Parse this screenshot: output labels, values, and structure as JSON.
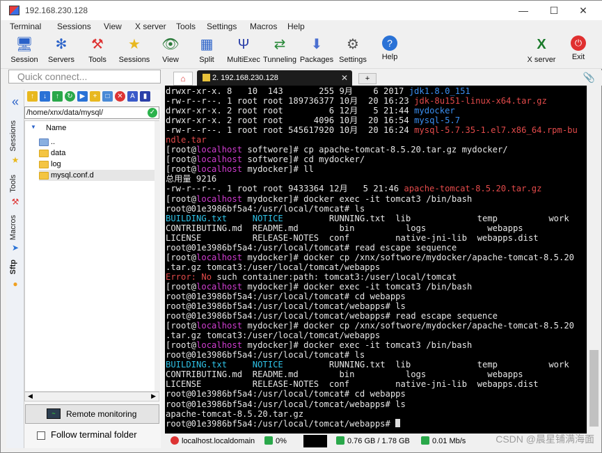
{
  "window": {
    "title": "192.168.230.128"
  },
  "menu": [
    "Terminal",
    "Sessions",
    "View",
    "X server",
    "Tools",
    "Settings",
    "Macros",
    "Help"
  ],
  "toolbar": {
    "items": [
      "Session",
      "Servers",
      "Tools",
      "Sessions",
      "View",
      "Split",
      "MultiExec",
      "Tunneling",
      "Packages",
      "Settings",
      "Help"
    ],
    "right": [
      "X server",
      "Exit"
    ]
  },
  "quick_connect": {
    "placeholder": "Quick connect..."
  },
  "side_tabs": [
    "Sessions",
    "Tools",
    "Macros",
    "Sftp"
  ],
  "sftp": {
    "path": "/home/xnx/data/mysql/",
    "column": "Name",
    "files": [
      "..",
      "data",
      "log",
      "mysql.conf.d"
    ]
  },
  "remote_monitoring": "Remote monitoring",
  "follow_folder": "Follow terminal folder",
  "tab": {
    "label": "2. 192.168.230.128"
  },
  "terminal": {
    "lines": [
      [
        [
          "drwxr-xr-x. 8   10  143       255 9月    6 2017 ",
          "w"
        ],
        [
          "jdk1.8.0_151",
          "b"
        ]
      ],
      [
        [
          "-rw-r--r--. 1 root root 189736377 10月  20 16:23 ",
          "w"
        ],
        [
          "jdk-8u151-linux-x64.tar.gz",
          "r"
        ]
      ],
      [
        [
          "drwxr-xr-x. 2 root root         6 12月   5 21:44 ",
          "w"
        ],
        [
          "mydocker",
          "b"
        ]
      ],
      [
        [
          "drwxr-xr-x. 2 root root      4096 10月  20 16:54 ",
          "w"
        ],
        [
          "mysql-5.7",
          "b"
        ]
      ],
      [
        [
          "-rw-r--r--. 1 root root 545617920 10月  20 16:24 ",
          "w"
        ],
        [
          "mysql-5.7.35-1.el7.x86_64.rpm-bu",
          "r"
        ]
      ],
      [
        [
          "ndle.tar",
          "r"
        ]
      ],
      [
        [
          "[root@",
          "w"
        ],
        [
          "localhost",
          "m"
        ],
        [
          " softwore]# cp apache-tomcat-8.5.20.tar.gz mydocker/",
          "w"
        ]
      ],
      [
        [
          "[root@",
          "w"
        ],
        [
          "localhost",
          "m"
        ],
        [
          " softwore]# cd mydocker/",
          "w"
        ]
      ],
      [
        [
          "[root@",
          "w"
        ],
        [
          "localhost",
          "m"
        ],
        [
          " mydocker]# ll",
          "w"
        ]
      ],
      [
        [
          "总用量 9216",
          "w"
        ]
      ],
      [
        [
          "-rw-r--r--. 1 root root 9433364 12月   5 21:46 ",
          "w"
        ],
        [
          "apache-tomcat-8.5.20.tar.gz",
          "r"
        ]
      ],
      [
        [
          "[root@",
          "w"
        ],
        [
          "localhost",
          "m"
        ],
        [
          " mydocker]# docker exec -it tomcat3 /bin/bash",
          "w"
        ]
      ],
      [
        [
          "root@01e3986bf5a4:/usr/local/tomcat# ls",
          "w"
        ]
      ],
      [
        [
          "BUILDING.txt",
          "c"
        ],
        [
          "     ",
          "w"
        ],
        [
          "NOTICE",
          "c"
        ],
        [
          "         RUNNING.txt  lib             temp          work",
          "w"
        ]
      ],
      [
        [
          "CONTRIBUTING.md  README.md        bin          logs            webapps",
          "w"
        ]
      ],
      [
        [
          "LICENSE          RELEASE-NOTES  conf         native-jni-lib  webapps.dist",
          "w"
        ]
      ],
      [
        [
          "root@01e3986bf5a4:/usr/local/tomcat# read escape sequence",
          "w"
        ]
      ],
      [
        [
          "[root@",
          "w"
        ],
        [
          "localhost",
          "m"
        ],
        [
          " mydocker]# docker cp /xnx/softwore/mydocker/apache-tomcat-8.5.20",
          "w"
        ]
      ],
      [
        [
          ".tar.gz tomcat3:/user/local/tomcat/webapps",
          "w"
        ]
      ],
      [
        [
          "Error: ",
          "r"
        ],
        [
          "No",
          "r"
        ],
        [
          " such container:path: tomcat3:/user/local/tomcat",
          "w"
        ]
      ],
      [
        [
          "[root@",
          "w"
        ],
        [
          "localhost",
          "m"
        ],
        [
          " mydocker]# docker exec -it tomcat3 /bin/bash",
          "w"
        ]
      ],
      [
        [
          "root@01e3986bf5a4:/usr/local/tomcat# cd webapps",
          "w"
        ]
      ],
      [
        [
          "root@01e3986bf5a4:/usr/local/tomcat/webapps# ls",
          "w"
        ]
      ],
      [
        [
          "root@01e3986bf5a4:/usr/local/tomcat/webapps# read escape sequence",
          "w"
        ]
      ],
      [
        [
          "[root@",
          "w"
        ],
        [
          "localhost",
          "m"
        ],
        [
          " mydocker]# docker cp /xnx/softwore/mydocker/apache-tomcat-8.5.20",
          "w"
        ]
      ],
      [
        [
          ".tar.gz tomcat3:/user/local/tomcat/webapps",
          "w"
        ]
      ],
      [
        [
          "[root@",
          "w"
        ],
        [
          "localhost",
          "m"
        ],
        [
          " mydocker]# docker exec -it tomcat3 /bin/bash",
          "w"
        ]
      ],
      [
        [
          "root@01e3986bf5a4:/usr/local/tomcat# ls",
          "w"
        ]
      ],
      [
        [
          "BUILDING.txt",
          "c"
        ],
        [
          "     ",
          "w"
        ],
        [
          "NOTICE",
          "c"
        ],
        [
          "         RUNNING.txt  lib             temp          work",
          "w"
        ]
      ],
      [
        [
          "CONTRIBUTING.md  README.md        bin          logs            webapps",
          "w"
        ]
      ],
      [
        [
          "LICENSE          RELEASE-NOTES  conf         native-jni-lib  webapps.dist",
          "w"
        ]
      ],
      [
        [
          "root@01e3986bf5a4:/usr/local/tomcat# cd webapps",
          "w"
        ]
      ],
      [
        [
          "root@01e3986bf5a4:/usr/local/tomcat/webapps# ls",
          "w"
        ]
      ],
      [
        [
          "apache-tomcat-8.5.20.tar.gz",
          "w"
        ]
      ],
      [
        [
          "root@01e3986bf5a4:/usr/local/tomcat/webapps# ",
          "w"
        ]
      ]
    ]
  },
  "status": {
    "host": "localhost.localdomain",
    "cpu": "0%",
    "mem": "0.76 GB / 1.78 GB",
    "net": "0.01 Mb/s"
  },
  "watermark": "CSDN @晨星铺满海面"
}
